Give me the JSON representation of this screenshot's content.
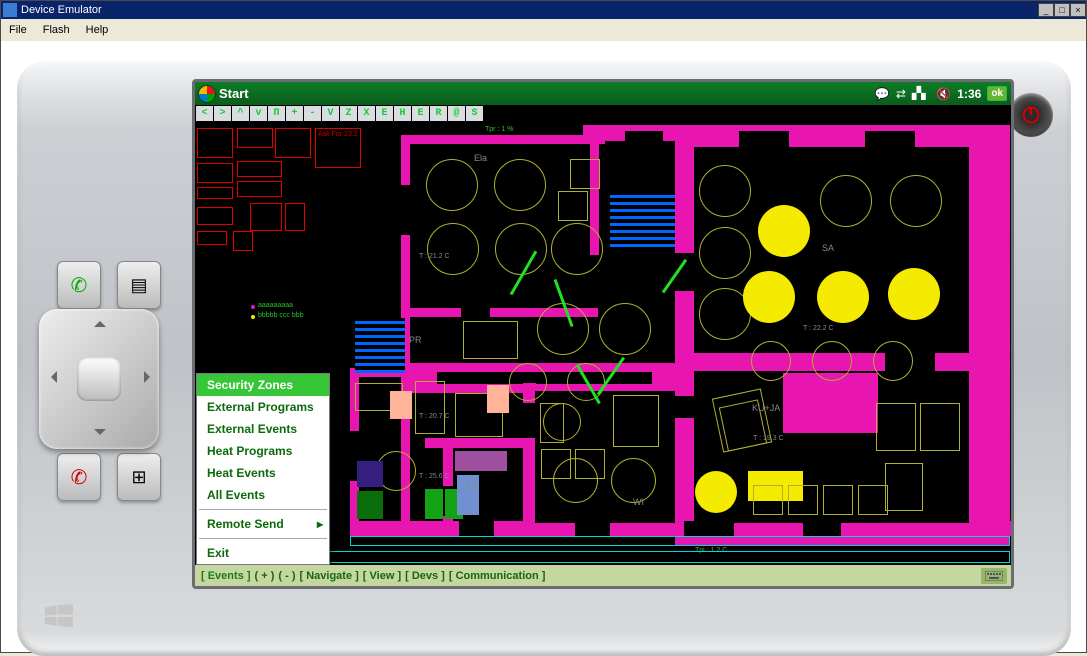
{
  "window": {
    "title": "Device Emulator",
    "menubar": [
      "File",
      "Flash",
      "Help"
    ]
  },
  "wm_statusbar": {
    "start": "Start",
    "time": "1:36",
    "ok": "ok"
  },
  "toolbar_buttons": [
    "<",
    ">",
    "^",
    "v",
    "П",
    "+",
    "-",
    "V",
    "Z",
    "X",
    "E",
    "H",
    "E",
    "R",
    "@",
    "S"
  ],
  "bottom_menu": {
    "active": "[ Events ]",
    "items": [
      "(  +  )",
      "(  -  )",
      "[ Navigate ]",
      "[ View ]",
      "[ Devs ]",
      "[ Communication ]"
    ]
  },
  "popup_menu": {
    "items": [
      "Security Zones",
      "External Programs",
      "External Events",
      "Heat Programs",
      "Heat Events",
      "All Events"
    ],
    "submenu_item": "Remote Send",
    "exit": "Exit",
    "selected_index": 0
  },
  "floorplan": {
    "room_labels": [
      "Ela",
      "SA",
      "PR",
      "KU+JA",
      "Ł1",
      "WI"
    ],
    "temp_labels": [
      "T : 21.2 C",
      "T : 20.7 C",
      "T : 25.6 C",
      "T : 22.2 C",
      "T : 19.3 C"
    ],
    "top_info": "Tpr : 1 %",
    "bottom_info": "Tpi : 1.2 C"
  }
}
